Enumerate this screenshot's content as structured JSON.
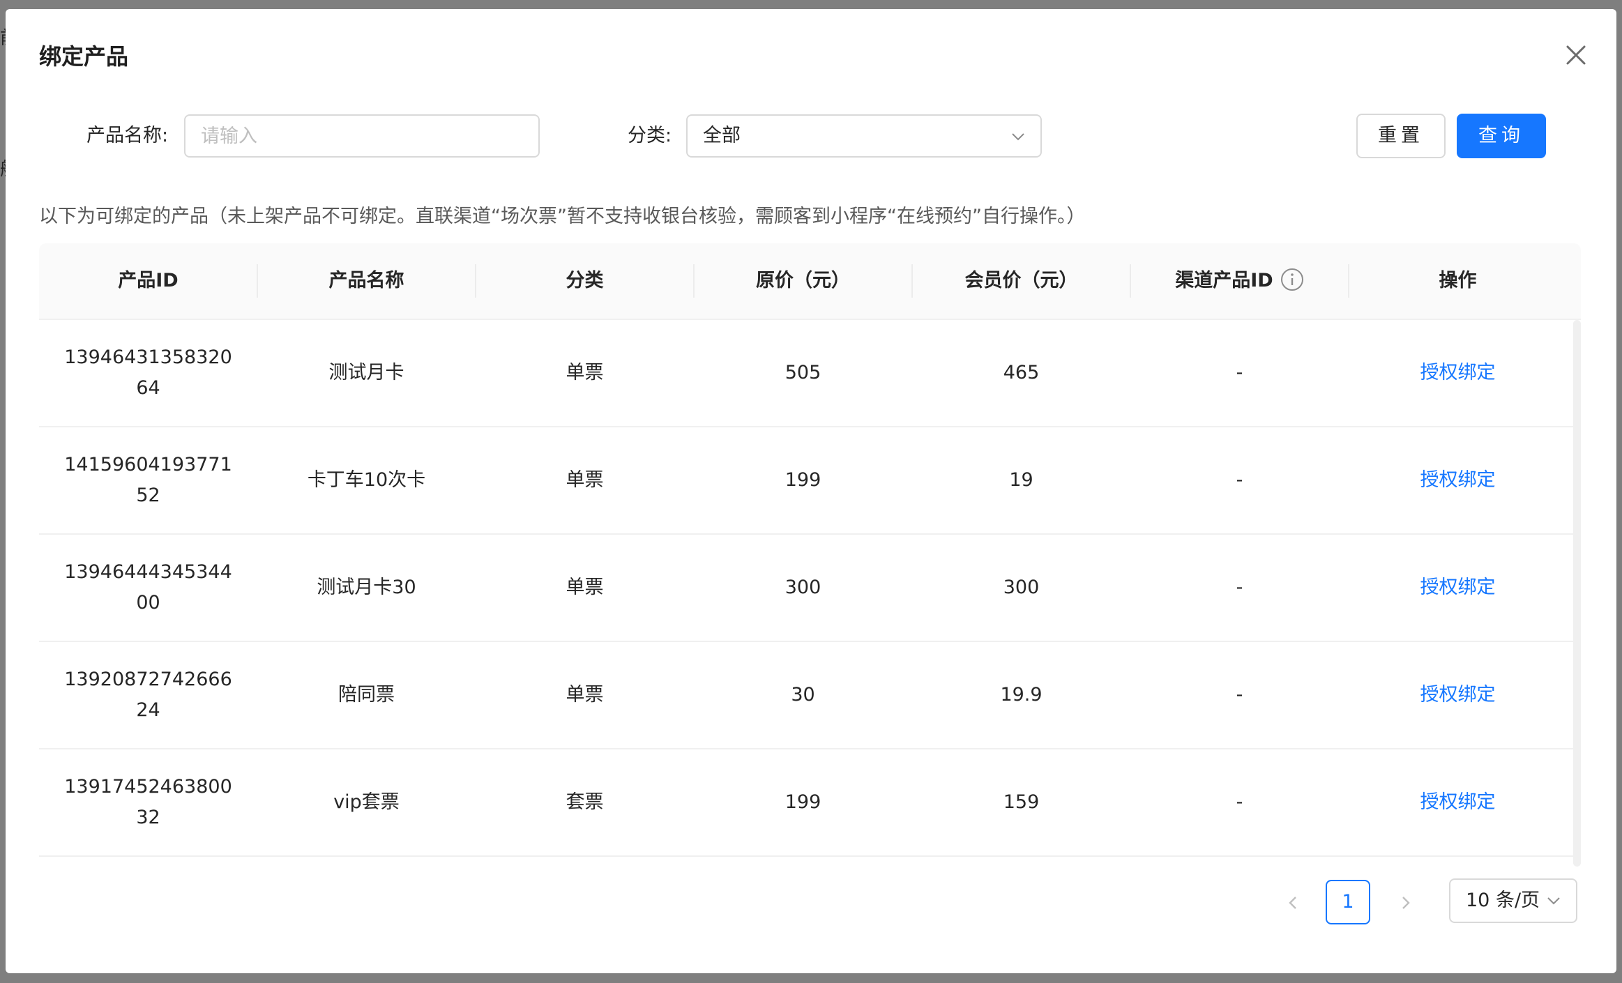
{
  "background": {
    "fragment_1": "前",
    "fragment_2": "船"
  },
  "modal": {
    "title": "绑定产品"
  },
  "search": {
    "name_label": "产品名称:",
    "name_placeholder": "请输入",
    "name_value": "",
    "category_label": "分类:",
    "category_value": "全部",
    "reset_label": "重置",
    "query_label": "查询"
  },
  "hint": "以下为可绑定的产品（未上架产品不可绑定。直联渠道“场次票”暂不支持收银台核验，需顾客到小程序“在线预约”自行操作。）",
  "table": {
    "columns": [
      "产品ID",
      "产品名称",
      "分类",
      "原价（元）",
      "会员价（元）",
      "渠道产品ID",
      "操作"
    ],
    "rows": [
      {
        "id": "1394643135832064",
        "name": "测试月卡",
        "category": "单票",
        "price": "505",
        "member_price": "465",
        "channel_id": "-",
        "action": "授权绑定"
      },
      {
        "id": "1415960419377152",
        "name": "卡丁车10次卡",
        "category": "单票",
        "price": "199",
        "member_price": "19",
        "channel_id": "-",
        "action": "授权绑定"
      },
      {
        "id": "1394644434534400",
        "name": "测试月卡30",
        "category": "单票",
        "price": "300",
        "member_price": "300",
        "channel_id": "-",
        "action": "授权绑定"
      },
      {
        "id": "1392087274266624",
        "name": "陪同票",
        "category": "单票",
        "price": "30",
        "member_price": "19.9",
        "channel_id": "-",
        "action": "授权绑定"
      },
      {
        "id": "1391745246380032",
        "name": "vip套票",
        "category": "套票",
        "price": "199",
        "member_price": "159",
        "channel_id": "-",
        "action": "授权绑定"
      }
    ]
  },
  "pagination": {
    "current_page": "1",
    "page_size_label": "10 条/页"
  },
  "colors": {
    "primary": "#1677ff",
    "border": "#d9d9d9",
    "header_bg": "#fafafa"
  }
}
